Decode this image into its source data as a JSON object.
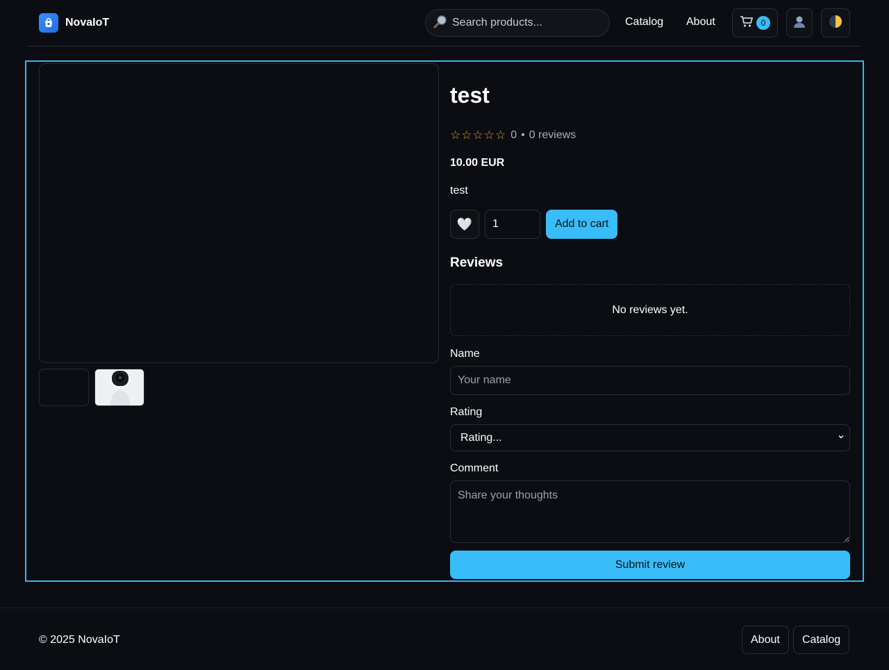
{
  "header": {
    "brand": "NovaIoT",
    "search_placeholder": "Search products...",
    "nav": [
      {
        "label": "Catalog"
      },
      {
        "label": "About"
      }
    ],
    "cart_count": "0"
  },
  "product": {
    "title": "test",
    "rating_value": "0",
    "reviews_count": "0 reviews",
    "price": "10.00 EUR",
    "description": "test",
    "quantity": "1",
    "add_to_cart_label": "Add to cart"
  },
  "reviews": {
    "heading": "Reviews",
    "empty_text": "No reviews yet.",
    "form": {
      "name_label": "Name",
      "name_placeholder": "Your name",
      "rating_label": "Rating",
      "rating_selected": "Rating...",
      "comment_label": "Comment",
      "comment_placeholder": "Share your thoughts",
      "submit_label": "Submit review"
    }
  },
  "footer": {
    "copyright": "© 2025 NovaIoT",
    "links": [
      {
        "label": "About"
      },
      {
        "label": "Catalog"
      }
    ]
  },
  "colors": {
    "accent": "#38bdf8",
    "background": "#0b0d12",
    "star": "#f0a020",
    "focus_outline": "#38b6f0"
  }
}
